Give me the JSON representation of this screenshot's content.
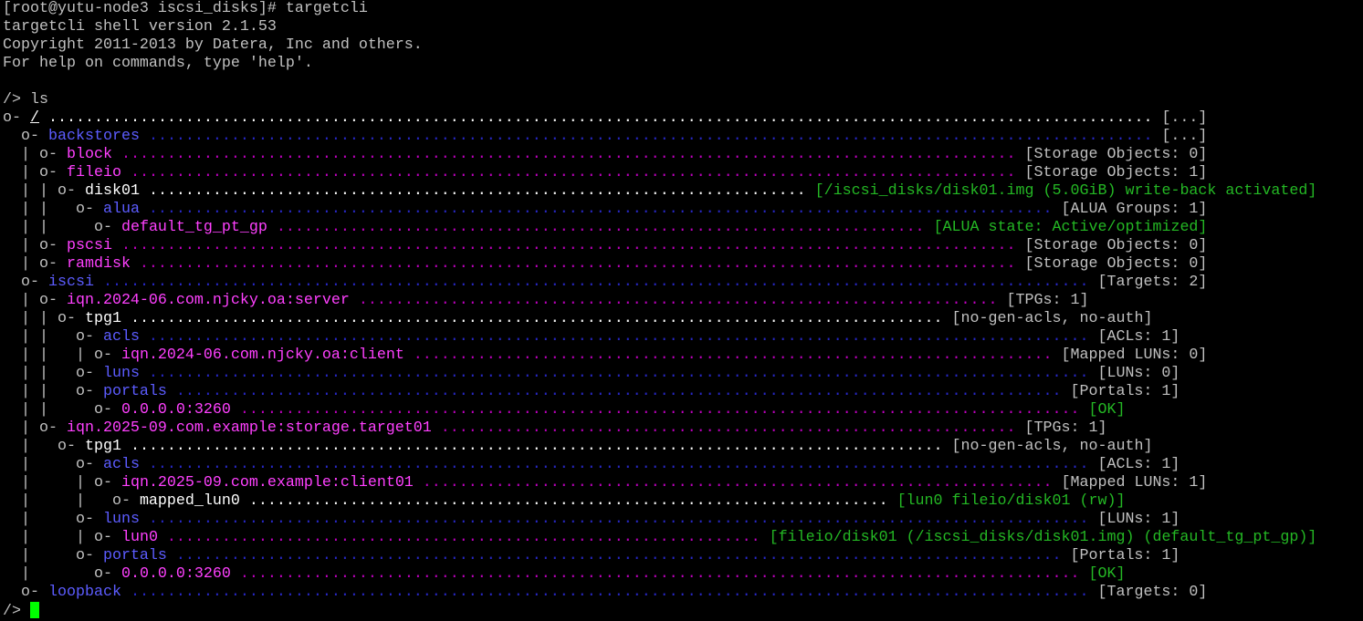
{
  "colors": {
    "background": "#000000",
    "default_text": "#c0c0c0",
    "bright_text": "#ffffff",
    "blue_name": "#5c5cff",
    "blue_dots": "#2828c8",
    "magenta_name": "#ff40ff",
    "magenta_dots": "#c000c0",
    "green_status": "#24b824",
    "cursor": "#00ff00"
  },
  "terminal": {
    "lines": [
      [
        {
          "t": "[root@yutu-node3 iscsi_disks]# targetcli",
          "c": "g"
        }
      ],
      [
        {
          "t": "targetcli shell version 2.1.53",
          "c": "g"
        }
      ],
      [
        {
          "t": "Copyright 2011-2013 by Datera, Inc and others.",
          "c": "g"
        }
      ],
      [
        {
          "t": "For help on commands, type 'help'.",
          "c": "g"
        }
      ],
      [
        {
          "t": "",
          "c": "g"
        }
      ],
      [
        {
          "t": "/> ls",
          "c": "g"
        }
      ],
      [
        {
          "t": "o- ",
          "c": "g"
        },
        {
          "t": "/",
          "c": "w ul"
        },
        {
          "t": " ......................................................................................................................... ",
          "c": "w"
        },
        {
          "t": "[...]",
          "c": "g"
        }
      ],
      [
        {
          "t": "  o- ",
          "c": "g"
        },
        {
          "t": "backstores",
          "c": "bl"
        },
        {
          "t": " .............................................................................................................. ",
          "c": "dbl"
        },
        {
          "t": "[...]",
          "c": "g"
        }
      ],
      [
        {
          "t": "  | o- ",
          "c": "g"
        },
        {
          "t": "block",
          "c": "mg"
        },
        {
          "t": " .................................................................................................. ",
          "c": "dmg"
        },
        {
          "t": "[Storage Objects: 0]",
          "c": "g"
        }
      ],
      [
        {
          "t": "  | o- ",
          "c": "g"
        },
        {
          "t": "fileio",
          "c": "mg"
        },
        {
          "t": " ................................................................................................. ",
          "c": "dmg"
        },
        {
          "t": "[Storage Objects: 1]",
          "c": "g"
        }
      ],
      [
        {
          "t": "  | | o- ",
          "c": "g"
        },
        {
          "t": "disk01",
          "c": "w"
        },
        {
          "t": " ........................................................................ ",
          "c": "w"
        },
        {
          "t": "[/iscsi_disks/disk01.img (5.0GiB) write-back activated]",
          "c": "gr"
        }
      ],
      [
        {
          "t": "  | |   o- ",
          "c": "g"
        },
        {
          "t": "alua",
          "c": "bl"
        },
        {
          "t": " ................................................................................................... ",
          "c": "dbl"
        },
        {
          "t": "[ALUA Groups: 1]",
          "c": "g"
        }
      ],
      [
        {
          "t": "  | |     o- ",
          "c": "g"
        },
        {
          "t": "default_tg_pt_gp",
          "c": "mg"
        },
        {
          "t": " ....................................................................... ",
          "c": "dmg"
        },
        {
          "t": "[ALUA state: Active/optimized]",
          "c": "gr"
        }
      ],
      [
        {
          "t": "  | o- ",
          "c": "g"
        },
        {
          "t": "pscsi",
          "c": "mg"
        },
        {
          "t": " .................................................................................................. ",
          "c": "dmg"
        },
        {
          "t": "[Storage Objects: 0]",
          "c": "g"
        }
      ],
      [
        {
          "t": "  | o- ",
          "c": "g"
        },
        {
          "t": "ramdisk",
          "c": "mg"
        },
        {
          "t": " ................................................................................................ ",
          "c": "dmg"
        },
        {
          "t": "[Storage Objects: 0]",
          "c": "g"
        }
      ],
      [
        {
          "t": "  o- ",
          "c": "g"
        },
        {
          "t": "iscsi",
          "c": "bl"
        },
        {
          "t": " ............................................................................................................ ",
          "c": "dbl"
        },
        {
          "t": "[Targets: 2]",
          "c": "g"
        }
      ],
      [
        {
          "t": "  | o- ",
          "c": "g"
        },
        {
          "t": "iqn.2024-06.com.njcky.oa:server",
          "c": "mg"
        },
        {
          "t": " ...................................................................... ",
          "c": "dmg"
        },
        {
          "t": "[TPGs: 1]",
          "c": "g"
        }
      ],
      [
        {
          "t": "  | | o- ",
          "c": "g"
        },
        {
          "t": "tpg1",
          "c": "w"
        },
        {
          "t": " ......................................................................................... ",
          "c": "w"
        },
        {
          "t": "[no-gen-acls, no-auth]",
          "c": "g"
        }
      ],
      [
        {
          "t": "  | |   o- ",
          "c": "g"
        },
        {
          "t": "acls",
          "c": "bl"
        },
        {
          "t": " ....................................................................................................... ",
          "c": "dbl"
        },
        {
          "t": "[ACLs: 1]",
          "c": "g"
        }
      ],
      [
        {
          "t": "  | |   | o- ",
          "c": "g"
        },
        {
          "t": "iqn.2024-06.com.njcky.oa:client",
          "c": "mg"
        },
        {
          "t": " ...................................................................... ",
          "c": "dmg"
        },
        {
          "t": "[Mapped LUNs: 0]",
          "c": "g"
        }
      ],
      [
        {
          "t": "  | |   o- ",
          "c": "g"
        },
        {
          "t": "luns",
          "c": "bl"
        },
        {
          "t": " ....................................................................................................... ",
          "c": "dbl"
        },
        {
          "t": "[LUNs: 0]",
          "c": "g"
        }
      ],
      [
        {
          "t": "  | |   o- ",
          "c": "g"
        },
        {
          "t": "portals",
          "c": "bl"
        },
        {
          "t": " ................................................................................................. ",
          "c": "dbl"
        },
        {
          "t": "[Portals: 1]",
          "c": "g"
        }
      ],
      [
        {
          "t": "  | |     o- ",
          "c": "g"
        },
        {
          "t": "0.0.0.0:3260",
          "c": "mg"
        },
        {
          "t": " ............................................................................................ ",
          "c": "dmg"
        },
        {
          "t": "[OK]",
          "c": "gr"
        }
      ],
      [
        {
          "t": "  | o- ",
          "c": "g"
        },
        {
          "t": "iqn.2025-09.com.example:storage.target01",
          "c": "mg"
        },
        {
          "t": " ............................................................... ",
          "c": "dmg"
        },
        {
          "t": "[TPGs: 1]",
          "c": "g"
        }
      ],
      [
        {
          "t": "  |   o- ",
          "c": "g"
        },
        {
          "t": "tpg1",
          "c": "w"
        },
        {
          "t": " ......................................................................................... ",
          "c": "w"
        },
        {
          "t": "[no-gen-acls, no-auth]",
          "c": "g"
        }
      ],
      [
        {
          "t": "  |     o- ",
          "c": "g"
        },
        {
          "t": "acls",
          "c": "bl"
        },
        {
          "t": " ....................................................................................................... ",
          "c": "dbl"
        },
        {
          "t": "[ACLs: 1]",
          "c": "g"
        }
      ],
      [
        {
          "t": "  |     | o- ",
          "c": "g"
        },
        {
          "t": "iqn.2025-09.com.example:client01",
          "c": "mg"
        },
        {
          "t": " ..................................................................... ",
          "c": "dmg"
        },
        {
          "t": "[Mapped LUNs: 1]",
          "c": "g"
        }
      ],
      [
        {
          "t": "  |     |   o- ",
          "c": "g"
        },
        {
          "t": "mapped_lun0",
          "c": "w"
        },
        {
          "t": " ...................................................................... ",
          "c": "w"
        },
        {
          "t": "[lun0 fileio/disk01 (rw)]",
          "c": "gr"
        }
      ],
      [
        {
          "t": "  |     o- ",
          "c": "g"
        },
        {
          "t": "luns",
          "c": "bl"
        },
        {
          "t": " ....................................................................................................... ",
          "c": "dbl"
        },
        {
          "t": "[LUNs: 1]",
          "c": "g"
        }
      ],
      [
        {
          "t": "  |     | o- ",
          "c": "g"
        },
        {
          "t": "lun0",
          "c": "mg"
        },
        {
          "t": " ................................................................. ",
          "c": "dmg"
        },
        {
          "t": "[fileio/disk01 (/iscsi_disks/disk01.img) (default_tg_pt_gp)]",
          "c": "gr"
        }
      ],
      [
        {
          "t": "  |     o- ",
          "c": "g"
        },
        {
          "t": "portals",
          "c": "bl"
        },
        {
          "t": " ................................................................................................. ",
          "c": "dbl"
        },
        {
          "t": "[Portals: 1]",
          "c": "g"
        }
      ],
      [
        {
          "t": "  |       o- ",
          "c": "g"
        },
        {
          "t": "0.0.0.0:3260",
          "c": "mg"
        },
        {
          "t": " ............................................................................................ ",
          "c": "dmg"
        },
        {
          "t": "[OK]",
          "c": "gr"
        }
      ],
      [
        {
          "t": "  o- ",
          "c": "g"
        },
        {
          "t": "loopback",
          "c": "bl"
        },
        {
          "t": " ......................................................................................................... ",
          "c": "dbl"
        },
        {
          "t": "[Targets: 0]",
          "c": "g"
        }
      ]
    ],
    "prompt": "/> "
  }
}
